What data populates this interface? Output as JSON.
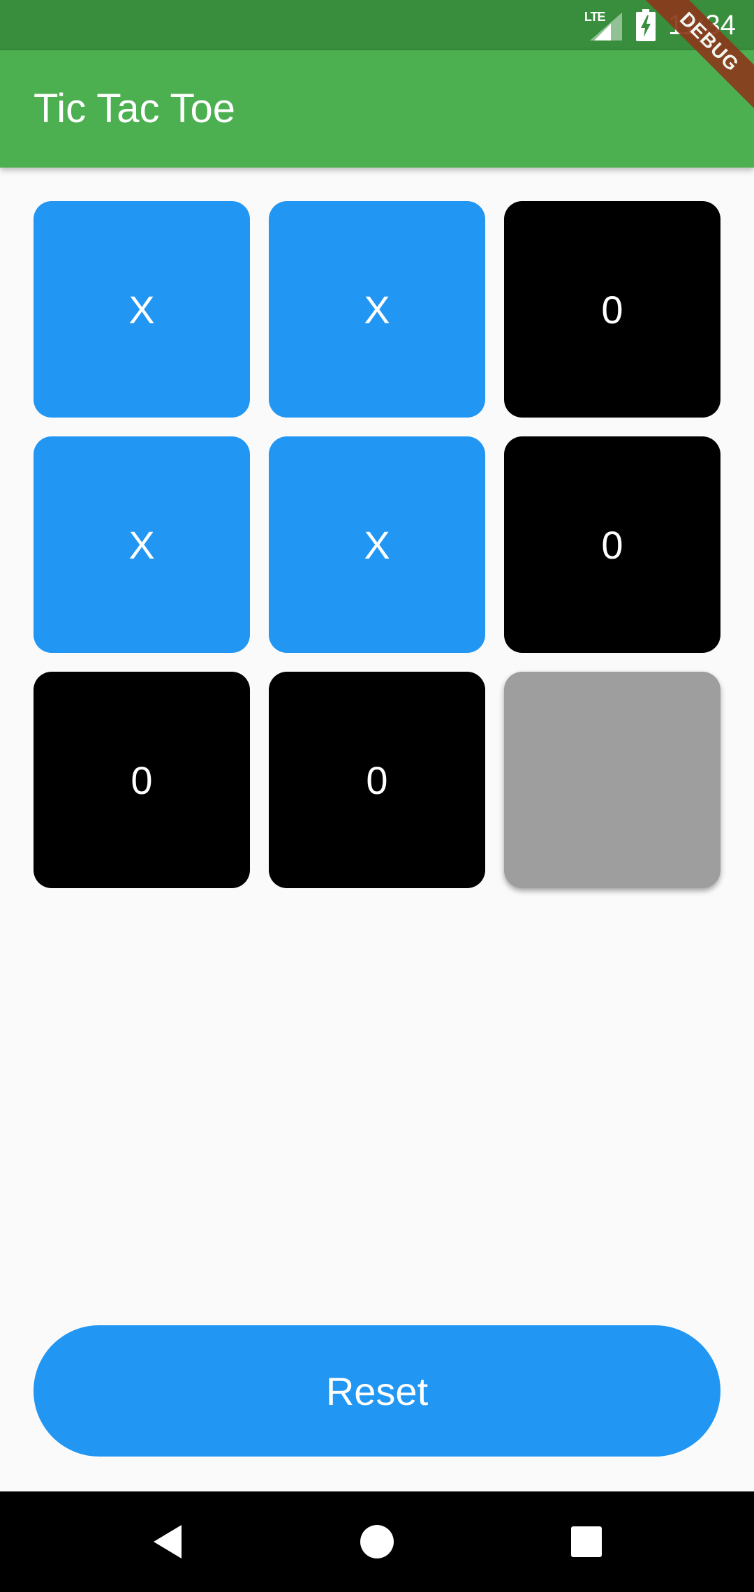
{
  "status_bar": {
    "network": "LTE",
    "time": "11:34",
    "icons": [
      "lte-signal-icon",
      "battery-charging-icon"
    ]
  },
  "debug_banner": "DEBUG",
  "app_bar": {
    "title": "Tic Tac Toe"
  },
  "board": {
    "cells": [
      {
        "value": "X",
        "state": "x"
      },
      {
        "value": "X",
        "state": "x"
      },
      {
        "value": "0",
        "state": "o"
      },
      {
        "value": "X",
        "state": "x"
      },
      {
        "value": "X",
        "state": "x"
      },
      {
        "value": "0",
        "state": "o"
      },
      {
        "value": "0",
        "state": "o"
      },
      {
        "value": "0",
        "state": "o"
      },
      {
        "value": "",
        "state": "empty"
      }
    ]
  },
  "reset_button": {
    "label": "Reset"
  },
  "nav_bar": {
    "icons": [
      "back-icon",
      "home-icon",
      "recents-icon"
    ]
  },
  "colors": {
    "status_bar": "#388e3c",
    "app_bar": "#4caf50",
    "x_cell": "#2196f3",
    "o_cell": "#000000",
    "empty_cell": "#9e9e9e",
    "reset_button": "#2196f3",
    "background": "#fafafa",
    "debug_banner": "#8b3a1c"
  }
}
